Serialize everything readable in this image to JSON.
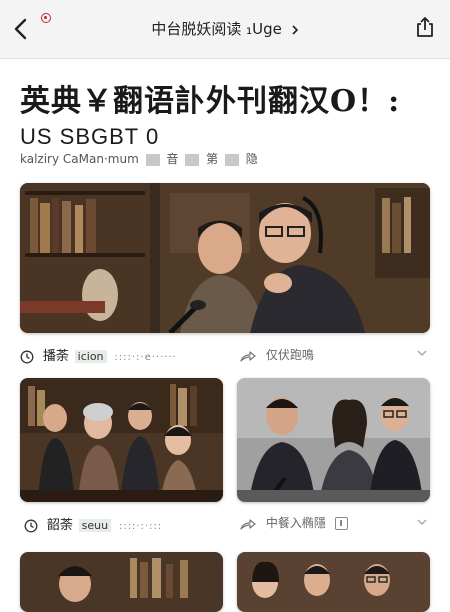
{
  "nav": {
    "title": "中台脱妖阅读 ₁Uge",
    "back_icon": "chevron-left-icon",
    "share_icon": "share-icon",
    "record_icon": "record-icon",
    "accent": "#c62828"
  },
  "article": {
    "headline": "英典￥翻语訃外刊翻汉O！:",
    "subhead": "US SBGBT 0",
    "subline_left": "kalziry CaMan·mum",
    "subline_right_a": "音",
    "subline_right_b": "第",
    "subline_right_c": "隐"
  },
  "cards": [
    {
      "id": "featured",
      "label": "播荼",
      "tag": "icion",
      "dots": "::::·:·e······",
      "action_label": "仅伏跑鳴",
      "clock_icon": "clock-icon",
      "action_icon": "forward-icon"
    },
    {
      "id": "left",
      "label": "韶荼",
      "tag": "seuu",
      "dots": "::::·:·:::",
      "clock_icon": "clock-icon"
    },
    {
      "id": "right",
      "action_label": "中餐入椭隱",
      "action_icon": "forward-icon"
    }
  ]
}
